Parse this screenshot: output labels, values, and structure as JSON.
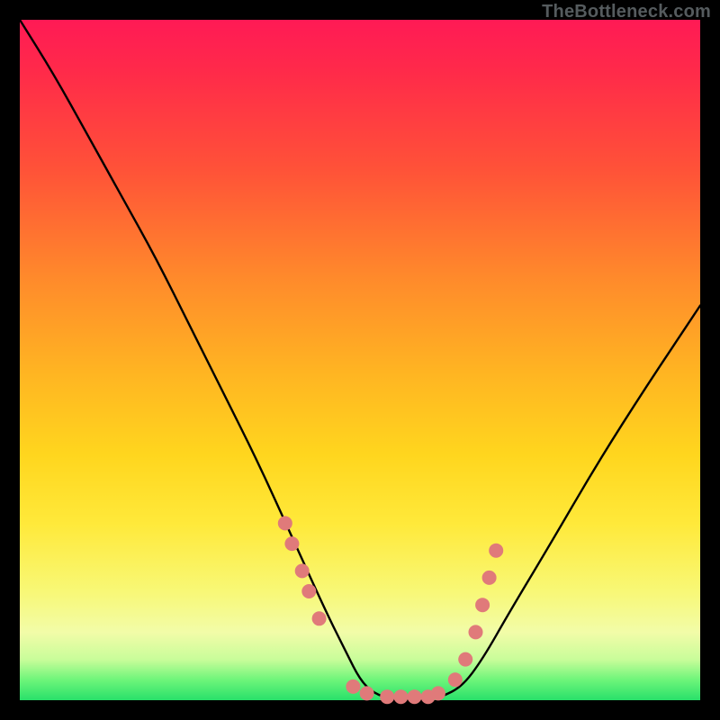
{
  "watermark": "TheBottleneck.com",
  "chart_data": {
    "type": "line",
    "title": "",
    "xlabel": "",
    "ylabel": "",
    "xlim": [
      0,
      100
    ],
    "ylim": [
      0,
      100
    ],
    "curve": {
      "name": "bottleneck-curve",
      "x": [
        0,
        5,
        10,
        15,
        20,
        25,
        30,
        35,
        40,
        45,
        48,
        50,
        52,
        55,
        58,
        60,
        62,
        65,
        68,
        72,
        78,
        85,
        92,
        100
      ],
      "y": [
        100,
        92,
        83,
        74,
        65,
        55,
        45,
        35,
        24,
        13,
        7,
        3,
        1,
        0,
        0,
        0,
        0.5,
        2,
        6,
        13,
        23,
        35,
        46,
        58
      ]
    },
    "markers": {
      "name": "highlight-dots",
      "color": "#e07a7a",
      "points": [
        {
          "x": 39.0,
          "y": 26
        },
        {
          "x": 40.0,
          "y": 23
        },
        {
          "x": 41.5,
          "y": 19
        },
        {
          "x": 42.5,
          "y": 16
        },
        {
          "x": 44.0,
          "y": 12
        },
        {
          "x": 49.0,
          "y": 2
        },
        {
          "x": 51.0,
          "y": 1
        },
        {
          "x": 54.0,
          "y": 0.5
        },
        {
          "x": 56.0,
          "y": 0.5
        },
        {
          "x": 58.0,
          "y": 0.5
        },
        {
          "x": 60.0,
          "y": 0.5
        },
        {
          "x": 61.5,
          "y": 1
        },
        {
          "x": 64.0,
          "y": 3
        },
        {
          "x": 65.5,
          "y": 6
        },
        {
          "x": 67.0,
          "y": 10
        },
        {
          "x": 68.0,
          "y": 14
        },
        {
          "x": 69.0,
          "y": 18
        },
        {
          "x": 70.0,
          "y": 22
        }
      ]
    },
    "gradient_stops": [
      {
        "pos": 0,
        "color": "#ff1a55"
      },
      {
        "pos": 22,
        "color": "#ff5238"
      },
      {
        "pos": 52,
        "color": "#ffb522"
      },
      {
        "pos": 74,
        "color": "#ffe93a"
      },
      {
        "pos": 90,
        "color": "#f2fca8"
      },
      {
        "pos": 100,
        "color": "#28e06a"
      }
    ]
  }
}
